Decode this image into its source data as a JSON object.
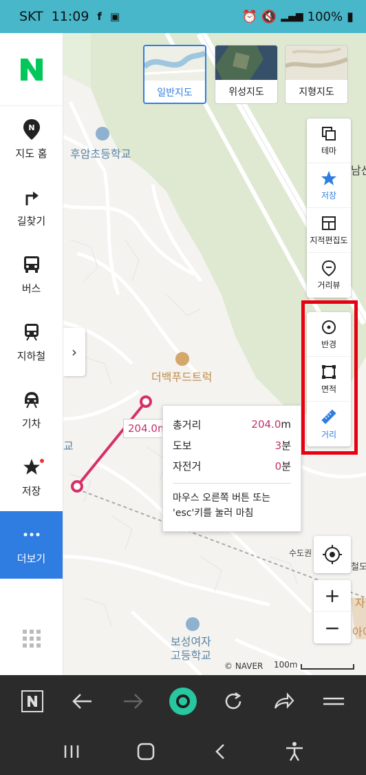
{
  "status_bar": {
    "carrier": "SKT",
    "time": "11:09",
    "battery": "100%"
  },
  "sidebar": {
    "items": [
      {
        "label": "지도 홈",
        "icon": "map-pin-icon"
      },
      {
        "label": "길찾기",
        "icon": "route-arrow-icon"
      },
      {
        "label": "버스",
        "icon": "bus-icon"
      },
      {
        "label": "지하철",
        "icon": "subway-icon"
      },
      {
        "label": "기차",
        "icon": "train-icon"
      },
      {
        "label": "저장",
        "icon": "star-icon"
      },
      {
        "label": "더보기",
        "icon": "more-dots-icon"
      }
    ],
    "active_index": 6
  },
  "map_types": [
    {
      "label": "일반지도",
      "selected": true
    },
    {
      "label": "위성지도",
      "selected": false
    },
    {
      "label": "지형지도",
      "selected": false
    }
  ],
  "toolbar_top": [
    {
      "label": "테마",
      "icon": "layers-icon"
    },
    {
      "label": "저장",
      "icon": "star-icon"
    },
    {
      "label": "지적편집도",
      "icon": "cadastral-icon"
    },
    {
      "label": "거리뷰",
      "icon": "street-view-icon"
    }
  ],
  "toolbar_measure": [
    {
      "label": "반경",
      "icon": "radius-icon"
    },
    {
      "label": "면적",
      "icon": "area-icon"
    },
    {
      "label": "거리",
      "icon": "ruler-icon"
    }
  ],
  "map_labels": {
    "school1": "후암초등학교",
    "restaurant": "더백푸드트럭",
    "school2_line1": "보성여자",
    "school2_line2": "고등학교",
    "road_edge": "남산",
    "road_bottom": "수도권",
    "left_edge": "교",
    "right_edge1": "철도",
    "right_edge2": "자",
    "right_edge3": "아이"
  },
  "measure": {
    "segment_tag": "204.0m",
    "total_label": "총거리",
    "total_value": "204.0",
    "total_unit": "m",
    "walk_label": "도보",
    "walk_value": "3",
    "walk_unit": "분",
    "bike_label": "자전거",
    "bike_value": "0",
    "bike_unit": "분",
    "hint": "마우스 오른쪽 버튼 또는 'esc'키를 눌러 마침"
  },
  "zoom": {
    "plus": "+",
    "minus": "−"
  },
  "copyright": "© NAVER",
  "scale": "100m"
}
